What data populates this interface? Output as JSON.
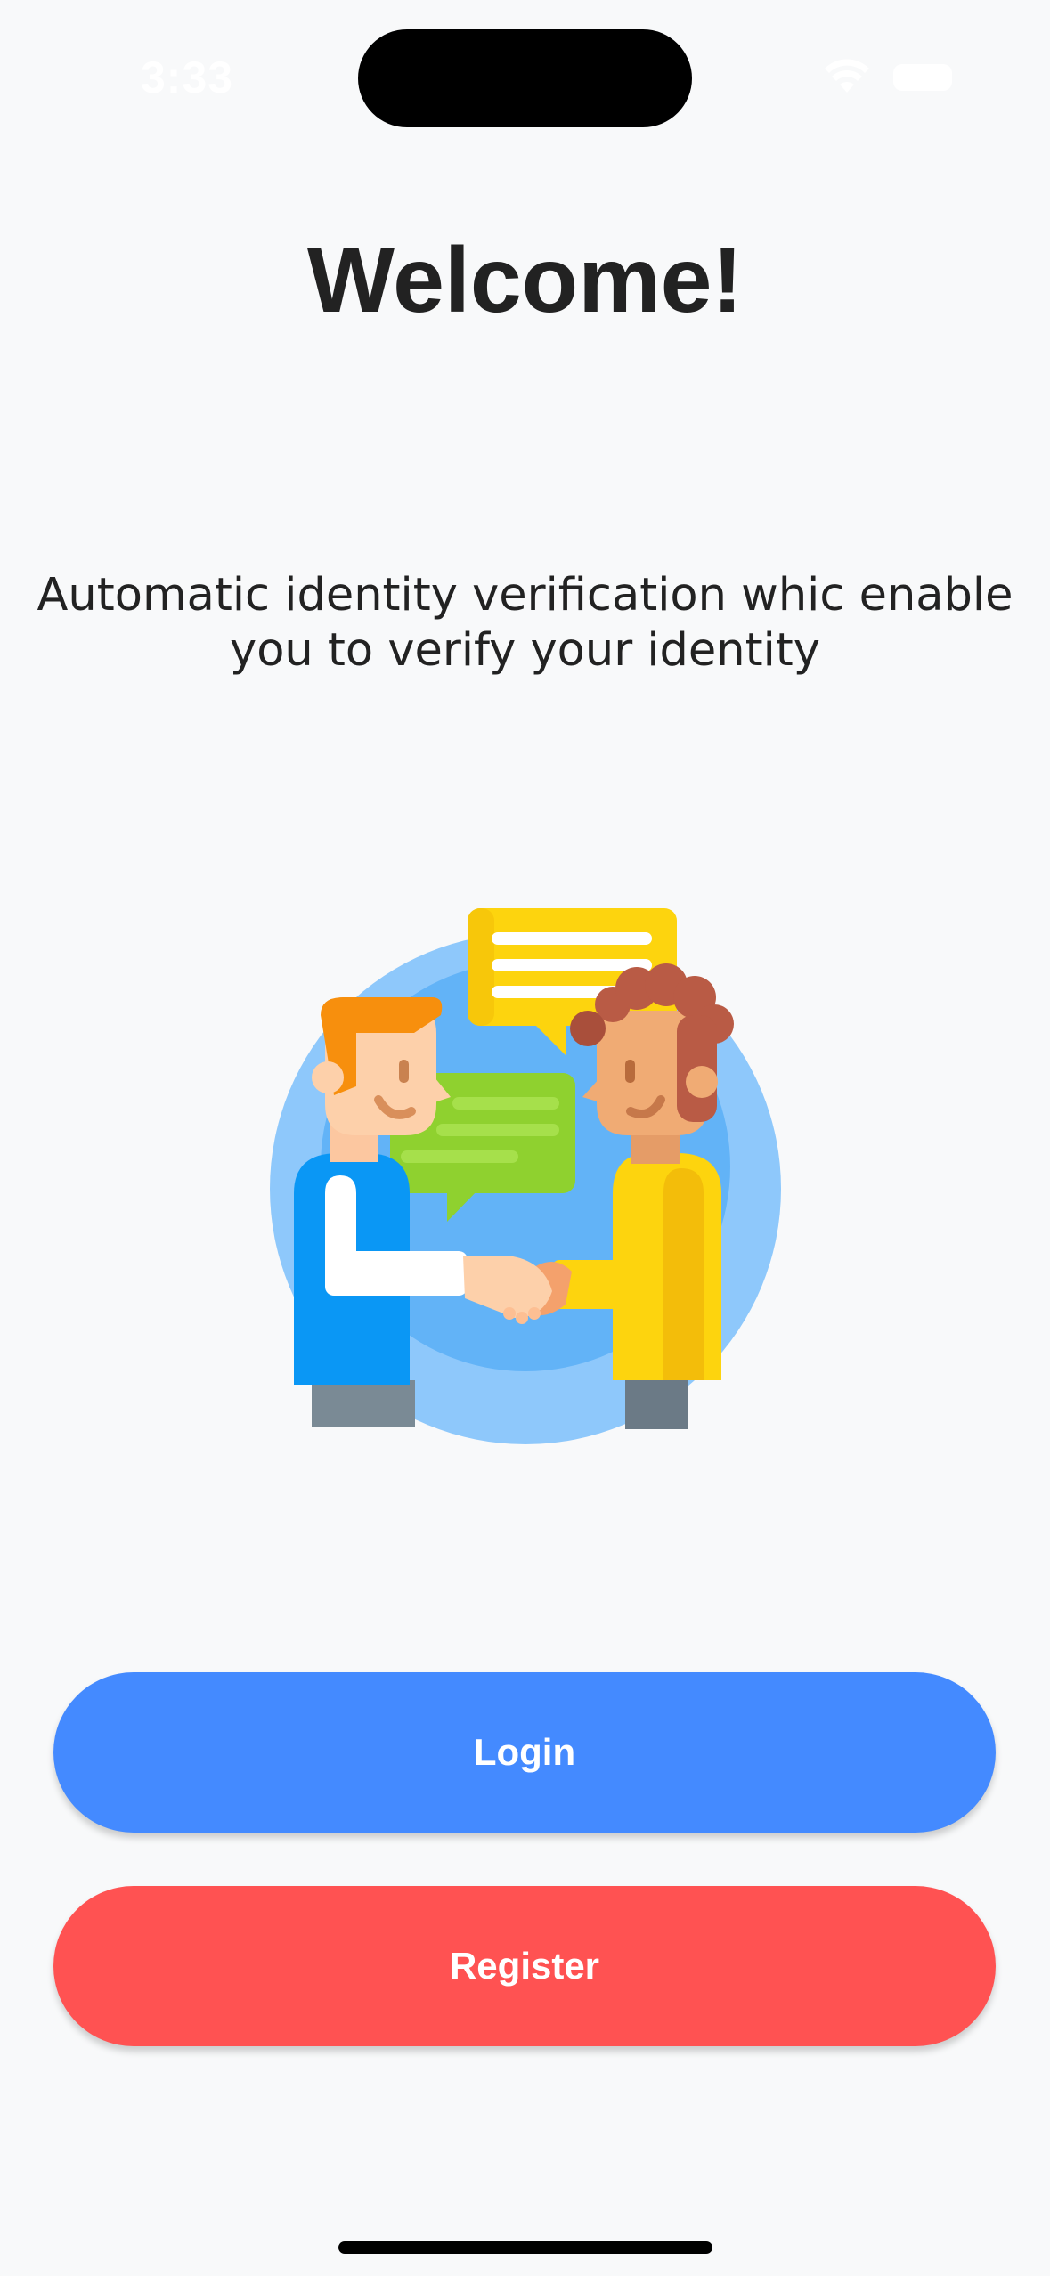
{
  "status_bar": {
    "time": "3:33"
  },
  "welcome": {
    "title": "Welcome!",
    "subtitle": "Automatic identity verification whic enable you to verify your identity"
  },
  "illustration": {
    "icon": "handshake-illustration"
  },
  "actions": {
    "login_label": "Login",
    "register_label": "Register"
  },
  "colors": {
    "background": "#f8f9fa",
    "login_button": "#448aff",
    "register_button": "#ff5252",
    "title_text": "#222222"
  }
}
